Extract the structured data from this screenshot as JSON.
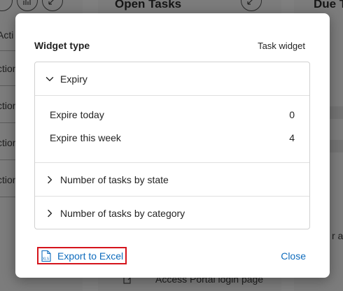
{
  "background": {
    "open_tasks_title": "Open Tasks",
    "due_title": "Due T",
    "left_partial_labels": [
      "Acti",
      "ction",
      "ction",
      "ction",
      "ction"
    ],
    "right_partial_label": "r al",
    "bottom_item": "Access Portal login page"
  },
  "modal": {
    "widget_type_label": "Widget type",
    "widget_type_value": "Task widget",
    "sections": [
      {
        "title": "Expiry",
        "expanded": true,
        "rows": [
          {
            "label": "Expire today",
            "value": "0"
          },
          {
            "label": "Expire this week",
            "value": "4"
          }
        ]
      },
      {
        "title": "Number of tasks by state",
        "expanded": false
      },
      {
        "title": "Number of tasks by category",
        "expanded": false
      }
    ],
    "export_label": "Export to Excel",
    "close_label": "Close"
  },
  "colors": {
    "link": "#0f6cbd",
    "highlight_border": "#d5141c"
  },
  "icons": [
    "chart-icon",
    "expand-icon",
    "chevron-down-icon",
    "chevron-right-icon",
    "excel-icon"
  ]
}
